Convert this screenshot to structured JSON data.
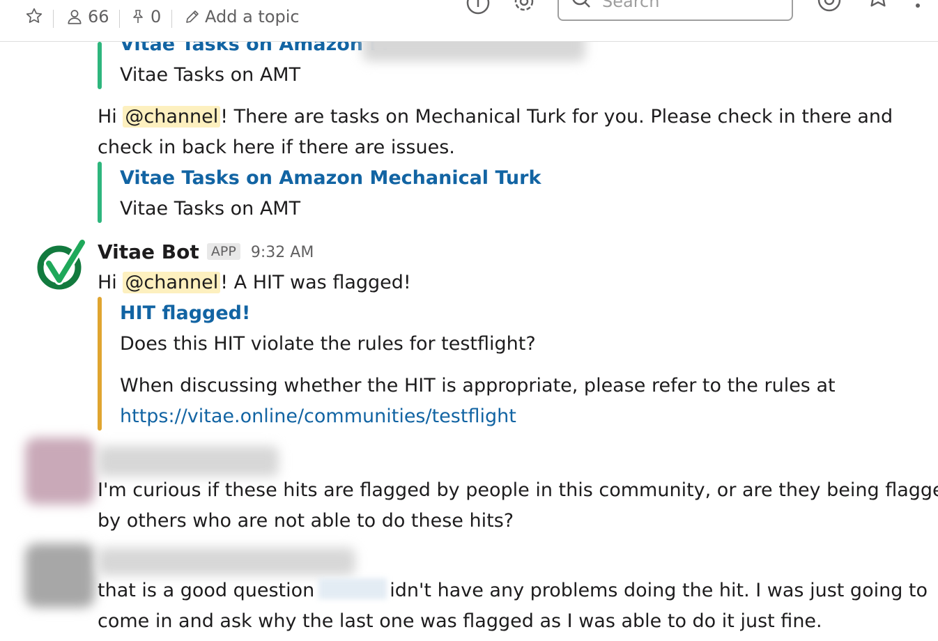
{
  "header": {
    "member_count": "66",
    "pinned_count": "0",
    "add_topic_label": "Add a topic",
    "search_placeholder": "Search"
  },
  "messages": [
    {
      "attachment_title_partial": "Vitae Tasks on Amazon M",
      "attachment_subtitle": "Vitae Tasks on AMT"
    },
    {
      "text_hi": "Hi",
      "mention": "@channel",
      "text_line1_rest": "! There are tasks on Mechanical Turk for you. Please check in there and",
      "text_line2": "check in back here if there are issues.",
      "attachment_title": "Vitae Tasks on Amazon Mechanical Turk",
      "attachment_subtitle": "Vitae Tasks on AMT"
    },
    {
      "sender": "Vitae Bot",
      "badge": "APP",
      "time": "9:32 AM",
      "text_hi": "Hi",
      "mention": "@channel",
      "text_rest": "! A HIT was flagged!",
      "attachment_title": "HIT flagged!",
      "attachment_line1": "Does this HIT violate the rules for testflight?",
      "attachment_line2": "When discussing whether the HIT is appropriate, please refer to the rules at",
      "attachment_url": "https://vitae.online/communities/testflight"
    },
    {
      "line1": "I'm curious if these hits are flagged by people in this community, or are they being flagged",
      "line2": "by others who are not able to do these hits?"
    },
    {
      "line1_part1": "that is a good question",
      "line1_part2": "idn't have any problems doing the hit. I was just going to",
      "line2": "come in and ask why the last one was flagged as I was able to do it just fine."
    }
  ],
  "colors": {
    "link": "#1264a3",
    "attachment_green": "#2eb67d",
    "attachment_gold": "#e0a530",
    "mention_bg": "#fdf0bf",
    "avatar_green": "#127a3e"
  }
}
